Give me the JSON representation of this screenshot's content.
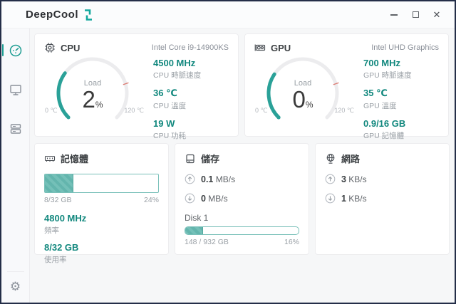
{
  "brand": {
    "name": "DeepCool"
  },
  "colors": {
    "accent_teal": "#12887e",
    "gauge_teal": "#2aa198",
    "bar_fill": "#6fbcb4",
    "warn_tick": "#dc7a72",
    "window_border": "#242e48"
  },
  "icons": {
    "settings_glyph": "⚙",
    "close_glyph": "✕",
    "sidebar": [
      "dashboard-gauge-icon",
      "display-icon",
      "devices-icon"
    ],
    "card_icons": [
      "cpu-chip-icon",
      "gpu-card-icon",
      "ram-icon",
      "disk-icon",
      "globe-icon"
    ]
  },
  "sidebar": {
    "items": [
      {
        "id": "dashboard",
        "active": true
      },
      {
        "id": "display",
        "active": false
      },
      {
        "id": "devices",
        "active": false
      }
    ],
    "settings_id": "settings"
  },
  "cards": {
    "cpu": {
      "title": "CPU",
      "device": "Intel Core i9-14900KS",
      "gauge": {
        "load_label": "Load",
        "load_value": "2",
        "load_unit": "%",
        "load_pct": 2,
        "min_label": "0 ℃",
        "max_label": "120 ℃",
        "temp_value": 36,
        "temp_max": 120
      },
      "stats": [
        {
          "value": "4500 MHz",
          "label": "CPU 時脈速度"
        },
        {
          "value": "36 ℃",
          "label": "CPU 溫度"
        },
        {
          "value": "19 W",
          "label": "CPU 功耗"
        }
      ]
    },
    "gpu": {
      "title": "GPU",
      "device": "Intel UHD Graphics",
      "gauge": {
        "load_label": "Load",
        "load_value": "0",
        "load_unit": "%",
        "load_pct": 0,
        "min_label": "0 ℃",
        "max_label": "120 ℃",
        "temp_value": 35,
        "temp_max": 120
      },
      "stats": [
        {
          "value": "700 MHz",
          "label": "GPU 時脈速度"
        },
        {
          "value": "35 ℃",
          "label": "GPU 溫度"
        },
        {
          "value": "0.9/16 GB",
          "label": "GPU 記憶體"
        }
      ]
    },
    "memory": {
      "title": "記憶體",
      "bar_pct": 25,
      "caption_left": "8/32 GB",
      "caption_right": "24%",
      "stats": [
        {
          "value": "4800 MHz",
          "label": "頻率"
        },
        {
          "value": "8/32 GB",
          "label": "使用率"
        }
      ]
    },
    "storage": {
      "title": "儲存",
      "up_value": "0.1",
      "up_unit": "MB/s",
      "down_value": "0",
      "down_unit": "MB/s",
      "disk_label": "Disk 1",
      "bar_pct": 16,
      "caption_left": "148 / 932 GB",
      "caption_right": "16%"
    },
    "network": {
      "title": "網路",
      "up_value": "3",
      "up_unit": "KB/s",
      "down_value": "1",
      "down_unit": "KB/s"
    }
  }
}
